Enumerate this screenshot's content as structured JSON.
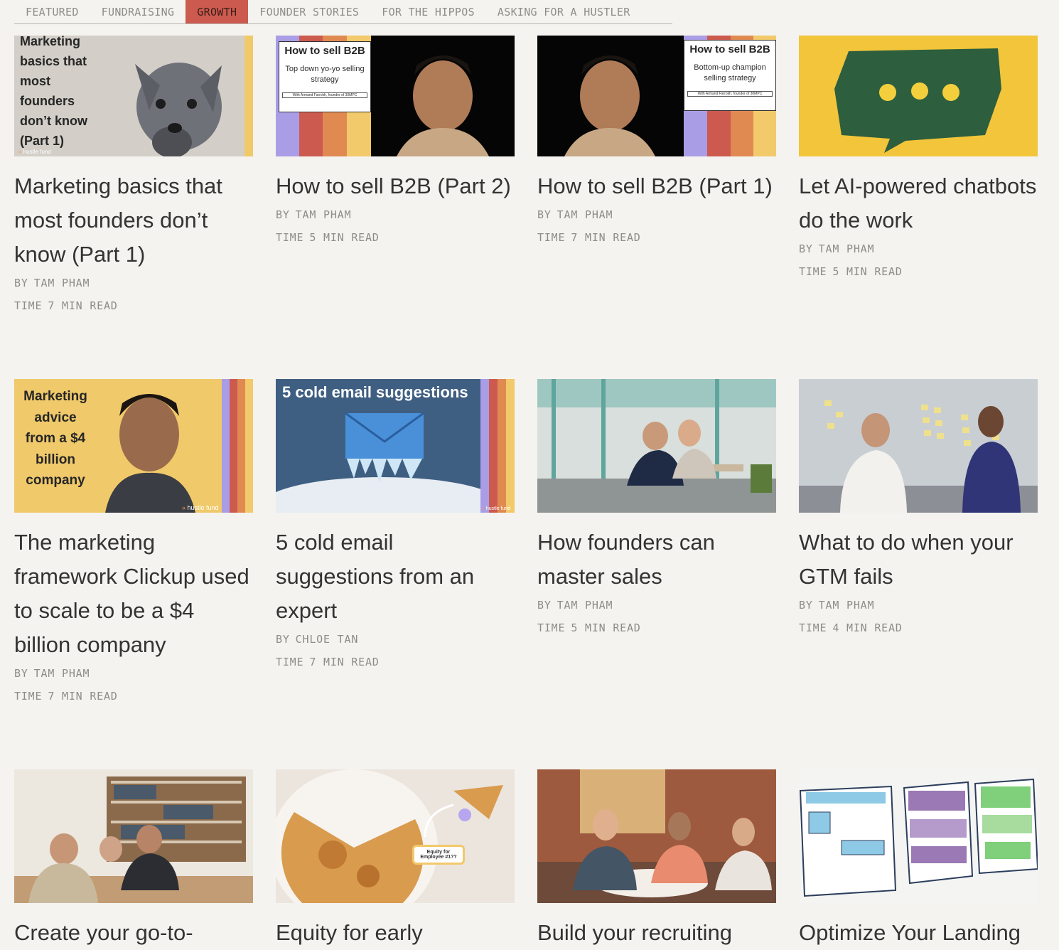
{
  "tabs": [
    {
      "label": "FEATURED"
    },
    {
      "label": "FUNDRAISING"
    },
    {
      "label": "GROWTH",
      "active": true
    },
    {
      "label": "FOUNDER STORIES"
    },
    {
      "label": "FOR THE HIPPOS"
    },
    {
      "label": "ASKING FOR A HUSTLER"
    }
  ],
  "meta_labels": {
    "by": "BY",
    "time": "TIME"
  },
  "brand": "hustle fund",
  "colors": {
    "accent": "#cc5a4e",
    "bg": "#f4f3ef",
    "stripe_purple": "#a99de6",
    "stripe_red": "#cc5a4e",
    "stripe_orange": "#e08a52",
    "stripe_yellow": "#f2c96b",
    "hf_yellow": "#f0c96a"
  },
  "articles": [
    {
      "title": "Marketing basics that most founders don’t know (Part 1)",
      "author": "TAM PHAM",
      "time": "7 MIN READ",
      "overlay": "Marketing basics that most founders don’t know (Part 1)"
    },
    {
      "title": "How to sell B2B (Part 2)",
      "author": "TAM PHAM",
      "time": "5 MIN READ",
      "overlay": {
        "heading": "How to sell B2B",
        "sub": "Top down yo-yo selling strategy",
        "credit": "With Armand Farrokh, founder of 30MPC"
      }
    },
    {
      "title": "How to sell B2B (Part 1)",
      "author": "TAM PHAM",
      "time": "7 MIN READ",
      "overlay": {
        "heading": "How to sell B2B",
        "sub": "Bottom-up champion selling strategy",
        "credit": "With Armand Farrokh, founder of 30MPC"
      }
    },
    {
      "title": "Let AI-powered chatbots do the work",
      "author": "TAM PHAM",
      "time": "5 MIN READ"
    },
    {
      "title": "The marketing framework Clickup used to scale to be a $4 billion company",
      "author": "TAM PHAM",
      "time": "7 MIN READ",
      "overlay": "Marketing advice from a $4 billion company"
    },
    {
      "title": "5 cold email suggestions from an expert",
      "author": "CHLOE TAN",
      "time": "7 MIN READ",
      "overlay": "5 cold email suggestions"
    },
    {
      "title": "How founders can master sales",
      "author": "TAM PHAM",
      "time": "5 MIN READ"
    },
    {
      "title": "What to do when your GTM fails",
      "author": "TAM PHAM",
      "time": "4 MIN READ"
    },
    {
      "title": "Create your go-to-"
    },
    {
      "title": "Equity for early",
      "overlay": "Equity for Employee #1??"
    },
    {
      "title": "Build your recruiting"
    },
    {
      "title": "Optimize Your Landing"
    }
  ]
}
